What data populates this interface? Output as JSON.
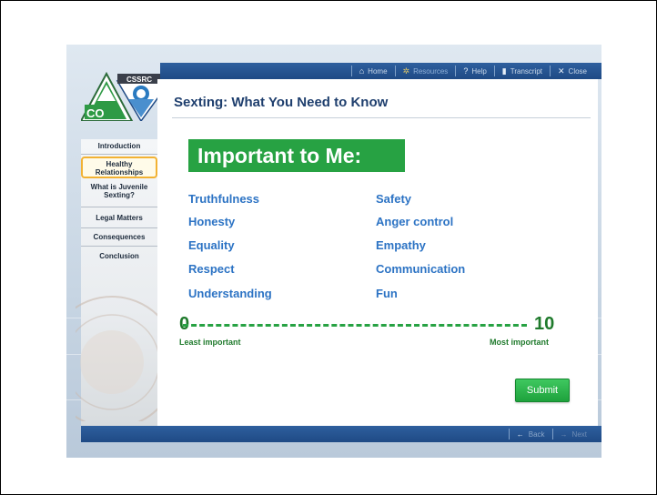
{
  "nav": {
    "home": "Home",
    "resources": "Resources",
    "help": "Help",
    "transcript": "Transcript",
    "close": "Close"
  },
  "logo": {
    "org": "CSSRC",
    "state": "CO"
  },
  "page": {
    "title": "Sexting: What You Need to Know",
    "heading": "Important to Me:"
  },
  "sidebar": {
    "items": [
      {
        "label": "Introduction"
      },
      {
        "label": "Healthy Relationships"
      },
      {
        "label": "What is Juvenile Sexting?"
      },
      {
        "label": "Legal Matters"
      },
      {
        "label": "Consequences"
      },
      {
        "label": "Conclusion"
      }
    ]
  },
  "values": {
    "left": [
      "Truthfulness",
      "Honesty",
      "Equality",
      "Respect",
      "Understanding"
    ],
    "right": [
      "Safety",
      "Anger control",
      "Empathy",
      "Communication",
      "Fun"
    ]
  },
  "scale": {
    "min": "0",
    "max": "10",
    "min_label": "Least important",
    "max_label": "Most important"
  },
  "submit_label": "Submit",
  "footer": {
    "back": "Back",
    "next": "Next"
  },
  "colors": {
    "nav_blue": "#1f4a85",
    "title_blue": "#1f3f6e",
    "value_blue": "#2c73c4",
    "green": "#27a243",
    "highlight": "#f2b233"
  }
}
